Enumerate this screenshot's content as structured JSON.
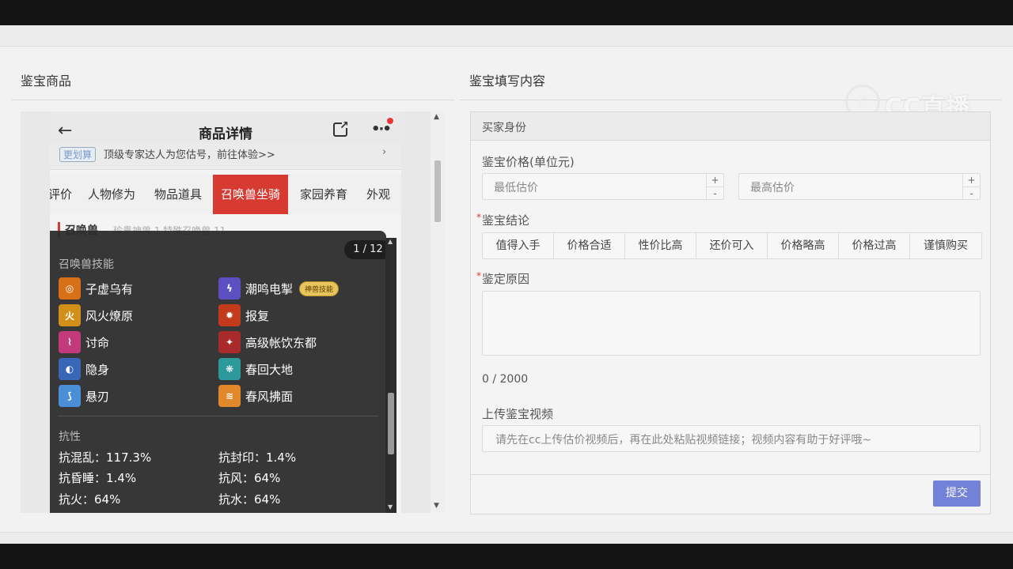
{
  "left": {
    "section_title": "鉴宝商品",
    "phone": {
      "title": "商品详情",
      "back_icon": "arrow-left-icon",
      "banner_tag": "更划算",
      "banner_text": "顶级专家达人为您估号，前往体验>>",
      "banner_arrow": "›",
      "tabs": [
        "评价",
        "人物修为",
        "物品道具",
        "召唤兽坐骑",
        "家园养育",
        "外观"
      ],
      "active_tab": "召唤兽坐骑",
      "sub_title": "召唤兽",
      "sub_extra": "珍贵神兽 1  特殊召唤兽 11",
      "overlay": {
        "counter": "1 / 12",
        "skills_heading": "召唤兽技能",
        "skills": [
          {
            "name": "子虚乌有",
            "icon": "swirl-skill-icon",
            "color": "#d8701a"
          },
          {
            "name": "潮鸣电掣",
            "icon": "lightning-skill-icon",
            "color": "#5b4fc2",
            "badge": "神兽技能"
          },
          {
            "name": "风火燎原",
            "icon": "fire-wind-skill-icon",
            "color": "#d39018",
            "glyph": "火"
          },
          {
            "name": "报复",
            "icon": "explosion-skill-icon",
            "color": "#c23b1c"
          },
          {
            "name": "讨命",
            "icon": "pink-swirl-skill-icon",
            "color": "#c23a7a"
          },
          {
            "name": "高级帐饮东都",
            "icon": "crimson-swirl-skill-icon",
            "color": "#a82a2a"
          },
          {
            "name": "隐身",
            "icon": "stealth-skill-icon",
            "color": "#3a66b8"
          },
          {
            "name": "春回大地",
            "icon": "spring-skill-icon",
            "color": "#2c9a9a"
          },
          {
            "name": "悬刃",
            "icon": "blade-skill-icon",
            "color": "#4a8fd8"
          },
          {
            "name": "春风拂面",
            "icon": "breeze-skill-icon",
            "color": "#e0882a"
          }
        ],
        "resist_heading": "抗性",
        "resists": [
          "抗混乱：117.3%",
          "抗封印：1.4%",
          "抗昏睡：1.4%",
          "抗风：64%",
          "抗火：64%",
          "抗水：64%"
        ]
      }
    }
  },
  "right": {
    "section_title": "鉴宝填写内容",
    "logo_text": "CC直播",
    "form": {
      "buyer_identity": "买家身份",
      "price_label": "鉴宝价格(单位元)",
      "min_price_placeholder": "最低估价",
      "max_price_placeholder": "最高估价",
      "stepper_plus": "+",
      "stepper_minus": "-",
      "conclusion_label": "鉴宝结论",
      "conclusions": [
        "值得入手",
        "价格合适",
        "性价比高",
        "还价可入",
        "价格略高",
        "价格过高",
        "谨慎购买"
      ],
      "reason_label": "鉴定原因",
      "required_mark": "*",
      "reason_counter": "0 / 2000",
      "video_label": "上传鉴宝视频",
      "video_placeholder": "请先在cc上传估价视频后，再在此处粘贴视频链接；视频内容有助于好评哦~",
      "submit_label": "提交"
    }
  }
}
